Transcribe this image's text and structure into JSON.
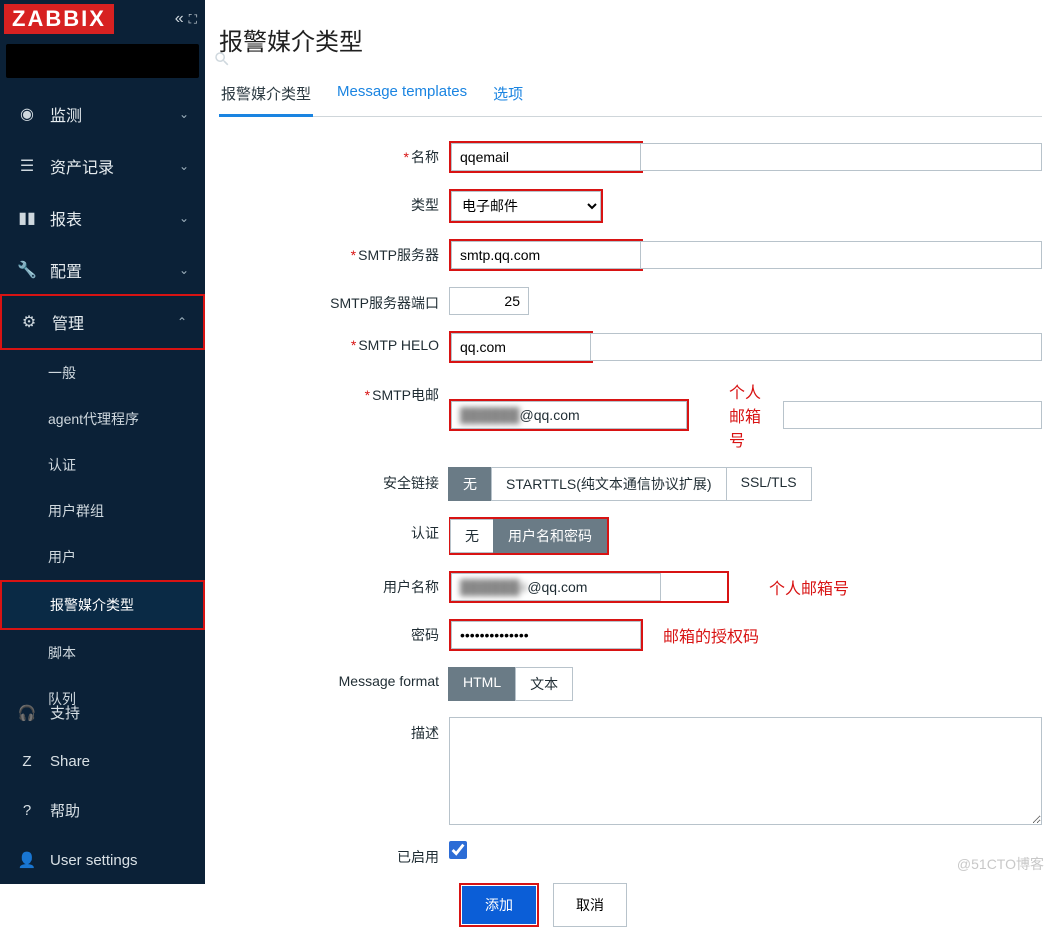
{
  "brand": "ZABBIX",
  "search": {
    "placeholder": ""
  },
  "nav": {
    "monitor": "监测",
    "inventory": "资产记录",
    "reports": "报表",
    "config": "配置",
    "admin": "管理",
    "sub": {
      "general": "一般",
      "agent": "agent代理程序",
      "auth": "认证",
      "usergroups": "用户群组",
      "users": "用户",
      "mediatypes": "报警媒介类型",
      "scripts": "脚本",
      "queue": "队列"
    },
    "support": "支持",
    "share": "Share",
    "help": "帮助",
    "usersettings": "User settings"
  },
  "page": {
    "title": "报警媒介类型",
    "tabs": {
      "mediatype": "报警媒介类型",
      "msg": "Message templates",
      "opt": "选项"
    },
    "labels": {
      "name": "名称",
      "type": "类型",
      "smtp_server": "SMTP服务器",
      "smtp_port": "SMTP服务器端口",
      "smtp_helo": "SMTP HELO",
      "smtp_email": "SMTP电邮",
      "security": "安全链接",
      "auth": "认证",
      "username": "用户名称",
      "password": "密码",
      "msgformat": "Message format",
      "desc": "描述",
      "enabled": "已启用"
    },
    "values": {
      "name": "qqemail",
      "type_option": "电子邮件",
      "smtp_server": "smtp.qq.com",
      "smtp_port": "25",
      "smtp_helo": "qq.com",
      "smtp_email_mask": "██████",
      "smtp_email_suffix": "@qq.com",
      "username_mask": "██████4",
      "username_suffix": "@qq.com",
      "password": "••••••••••••••",
      "desc": ""
    },
    "options": {
      "security": {
        "none": "无",
        "starttls": "STARTTLS(纯文本通信协议扩展)",
        "ssl": "SSL/TLS"
      },
      "auth": {
        "none": "无",
        "userpass": "用户名和密码"
      },
      "msgformat": {
        "html": "HTML",
        "text": "文本"
      }
    },
    "annot": {
      "email": "个人邮箱号",
      "authcode": "邮箱的授权码"
    },
    "buttons": {
      "add": "添加",
      "cancel": "取消"
    }
  },
  "watermark": "@51CTO博客"
}
